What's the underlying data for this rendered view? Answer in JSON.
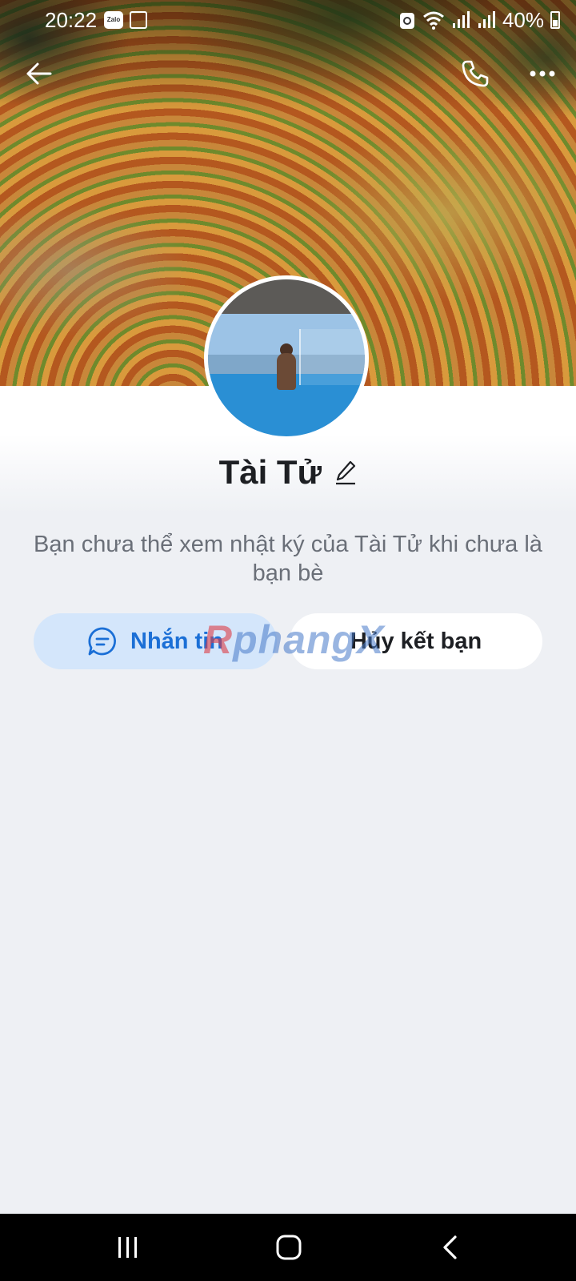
{
  "status_bar": {
    "time": "20:22",
    "battery": "40%",
    "app_badge": "Zalo"
  },
  "profile": {
    "name": "Tài Tử",
    "privacy_message": "Bạn chưa thể xem nhật ký của Tài Tử khi chưa là bạn bè"
  },
  "actions": {
    "message_label": "Nhắn tin",
    "unfriend_label": "Hủy kết bạn"
  },
  "watermark": {
    "prefix": "R",
    "rest": "phangX"
  },
  "icons": {
    "back": "arrow-left-icon",
    "call": "phone-icon",
    "more": "more-dots-icon",
    "edit": "pencil-icon",
    "chat": "chat-bubble-icon",
    "nav_recent": "recent-apps-icon",
    "nav_home": "home-icon",
    "nav_back": "chevron-left-icon"
  },
  "colors": {
    "accent": "#1b6fd6",
    "message_button_bg": "#d4e6fb",
    "page_bg": "#eef0f4"
  }
}
